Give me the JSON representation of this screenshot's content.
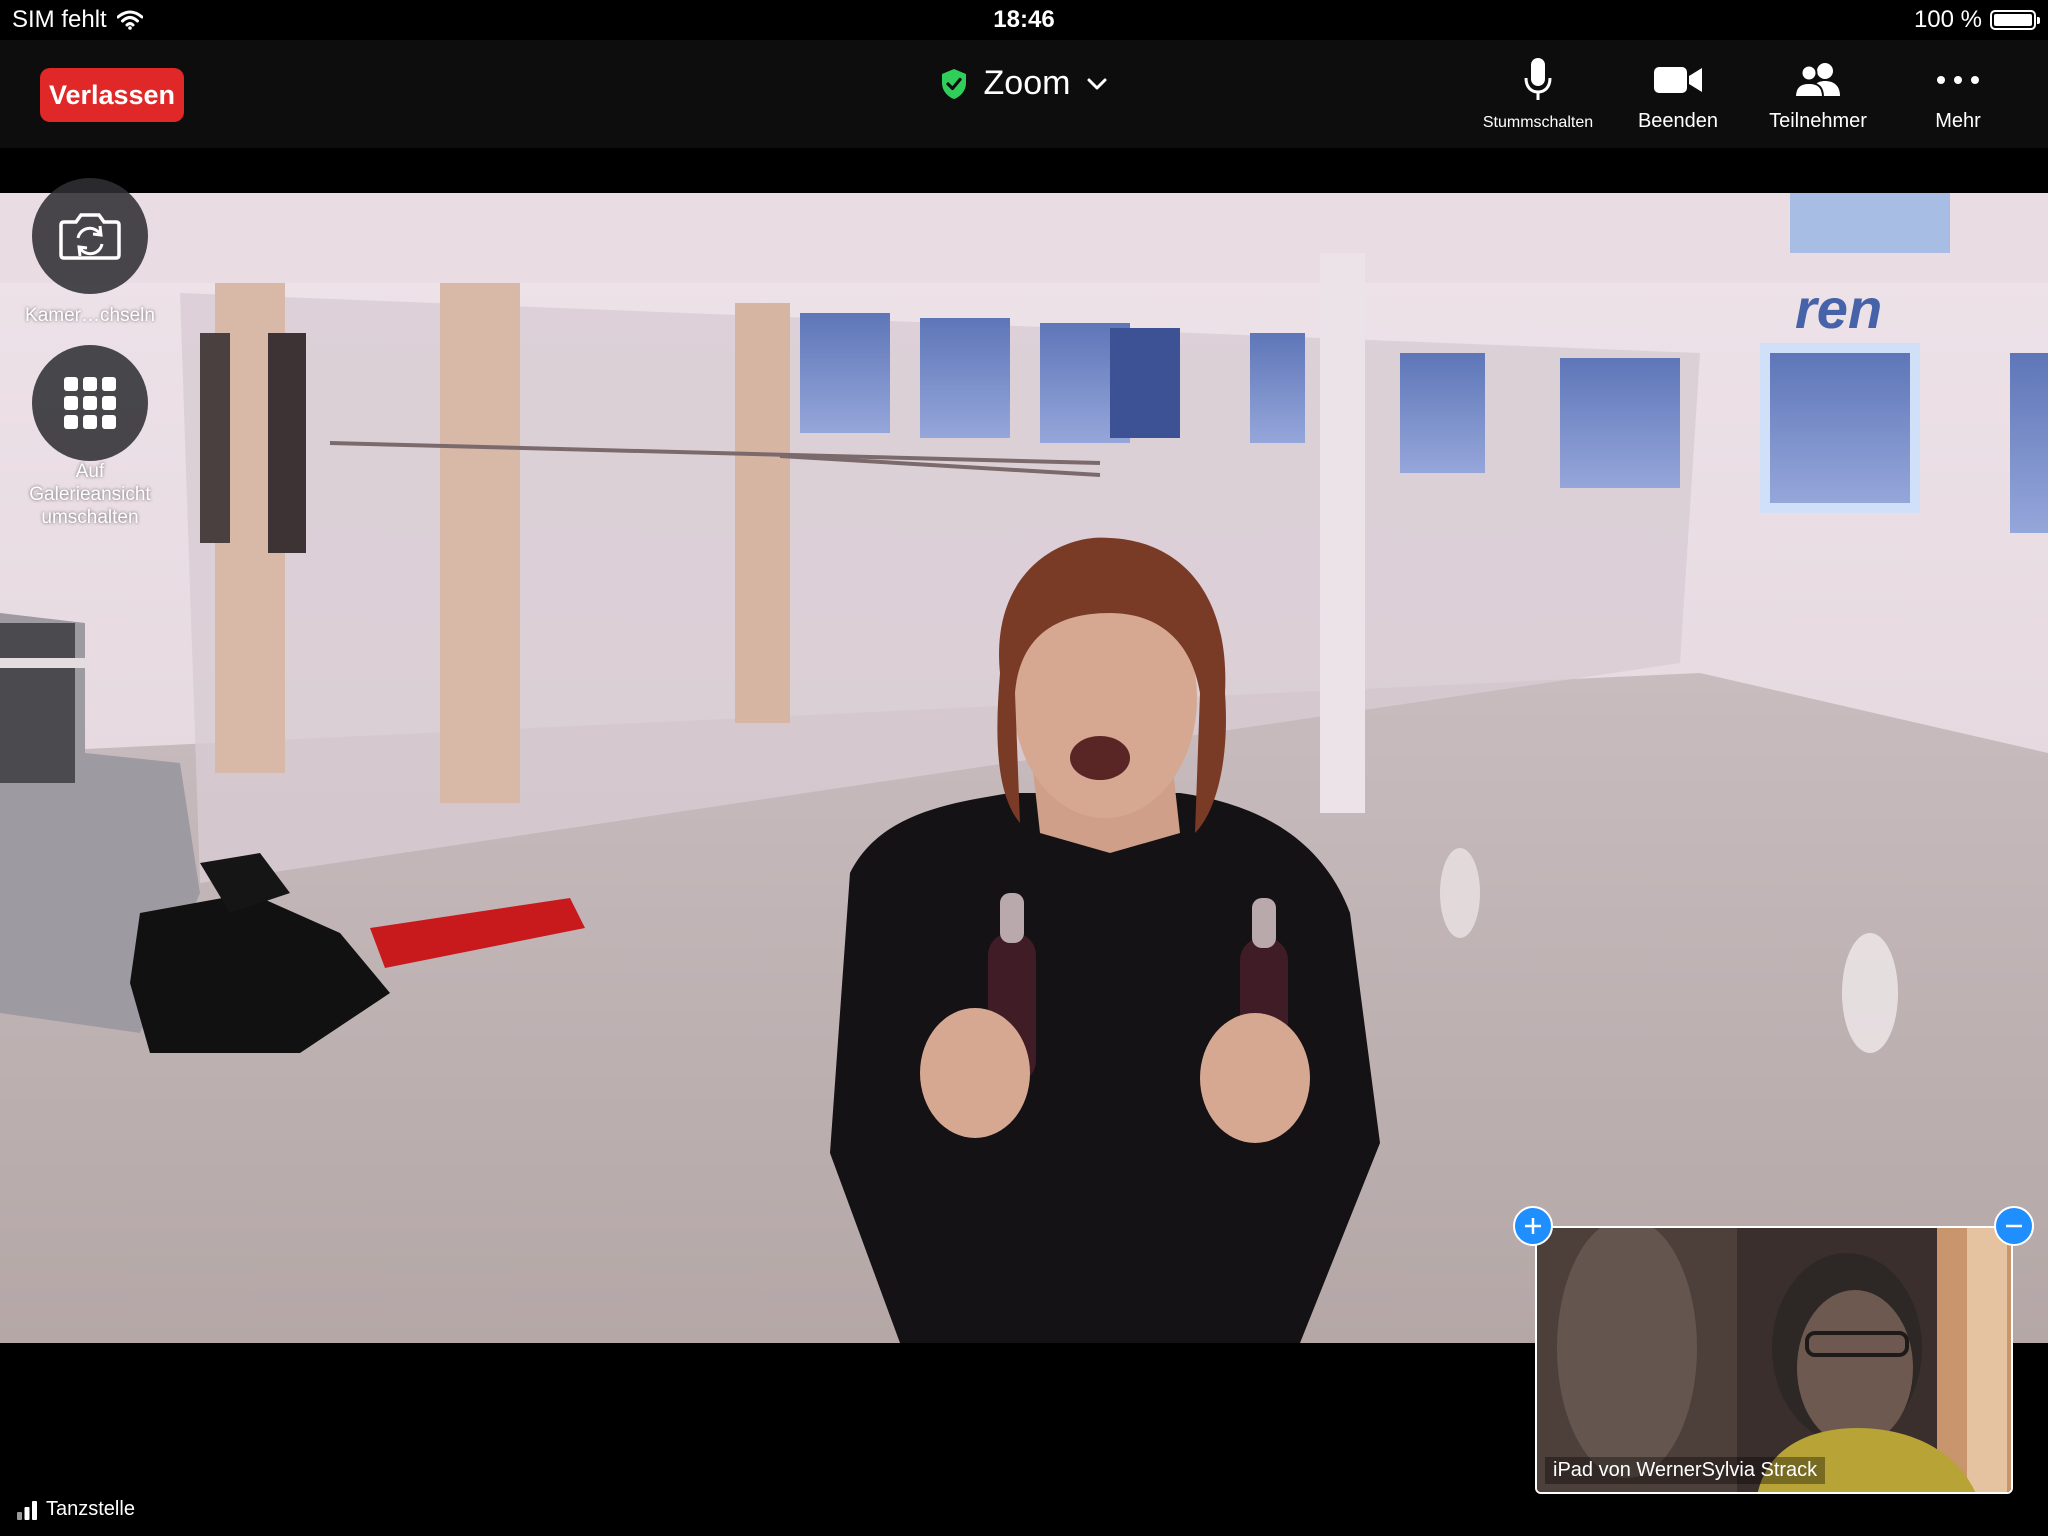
{
  "status_bar": {
    "carrier": "SIM fehlt",
    "time": "18:46",
    "battery": "100 %",
    "battery_level": 1.0
  },
  "toolbar": {
    "leave_label": "Verlassen",
    "leave_color": "#e02828",
    "meeting_title": "Zoom",
    "security_icon": "shield-check-icon",
    "security_color": "#2fcf5a",
    "tools": [
      {
        "label": "Stummschalten",
        "icon": "microphone-icon"
      },
      {
        "label": "Beenden",
        "icon": "video-camera-icon"
      },
      {
        "label": "Teilnehmer",
        "icon": "participants-icon"
      },
      {
        "label": "Mehr",
        "icon": "more-dots-icon"
      }
    ]
  },
  "side_controls": {
    "switch_camera_label": "Kamer…chseln",
    "gallery_label_lines": [
      "Auf",
      "Galerieansicht",
      "umschalten"
    ]
  },
  "video": {
    "studio_sign_text": "ren"
  },
  "self_view": {
    "name": "iPad von WernerSylvia Strack",
    "accent_color": "#1f8eff"
  },
  "footer": {
    "active_speaker": "Tanzstelle",
    "signal_icon": "signal-bars-icon"
  }
}
